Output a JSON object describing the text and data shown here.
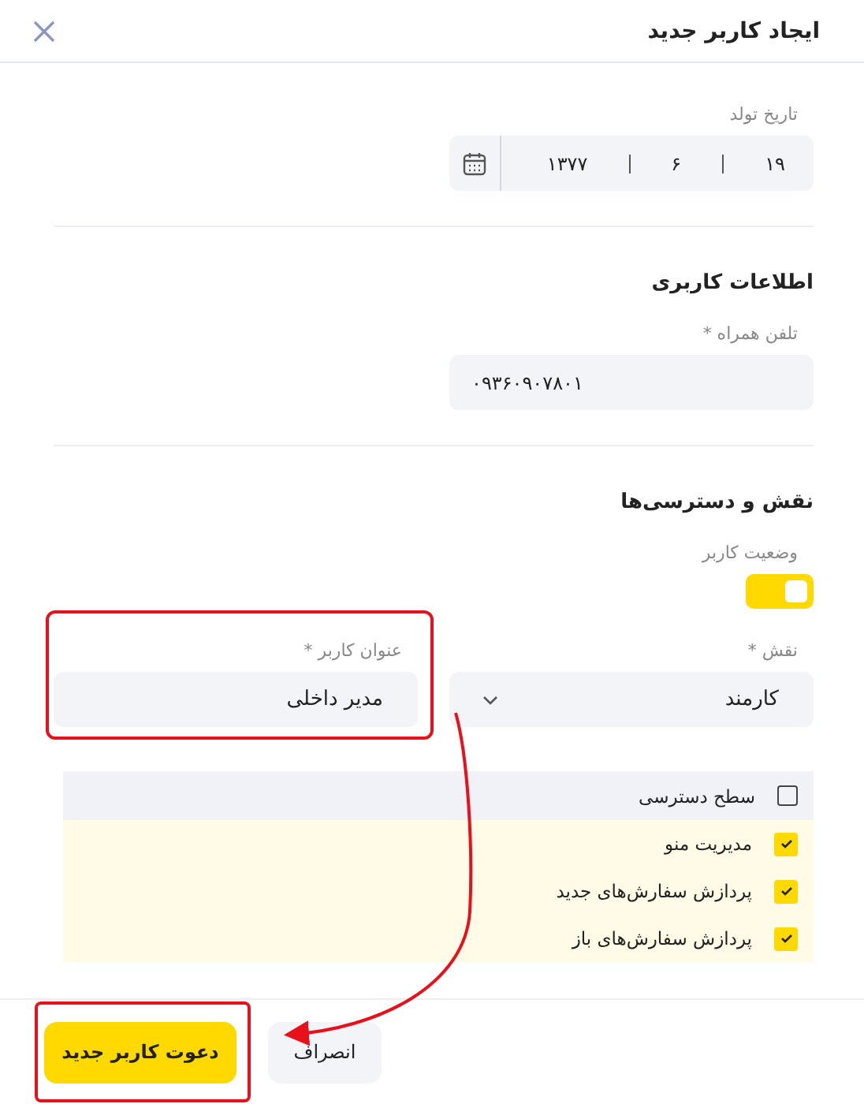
{
  "dialog": {
    "title": "ایجاد کاربر جدید"
  },
  "birth_date": {
    "label": "تاریخ تولد",
    "day": "۱۹",
    "month": "۶",
    "year": "۱۳۷۷"
  },
  "user_info": {
    "heading": "اطلاعات کاربری",
    "phone": {
      "label": "تلفن همراه *",
      "value": "۰۹۳۶۰۹۰۷۸۰۱"
    }
  },
  "roles": {
    "heading": "نقش و دسترسی‌ها",
    "status": {
      "label": "وضعیت کاربر",
      "on": true
    },
    "role": {
      "label": "نقش *",
      "value": "کارمند"
    },
    "user_title": {
      "label": "عنوان کاربر *",
      "value": "مدیر داخلی",
      "highlighted": true
    },
    "access": {
      "header": {
        "label": "سطح دسترسی",
        "checked": false
      },
      "items": [
        {
          "label": "مدیریت منو",
          "checked": true
        },
        {
          "label": "پردازش سفارش‌های جدید",
          "checked": true
        },
        {
          "label": "پردازش سفارش‌های باز",
          "checked": true
        }
      ]
    }
  },
  "buttons": [
    {
      "label": "انصراف",
      "kind": "secondary",
      "highlighted": false
    },
    {
      "label": "دعوت کاربر جدید",
      "kind": "primary",
      "highlighted": true
    }
  ],
  "annotation": {
    "arrow": true
  }
}
